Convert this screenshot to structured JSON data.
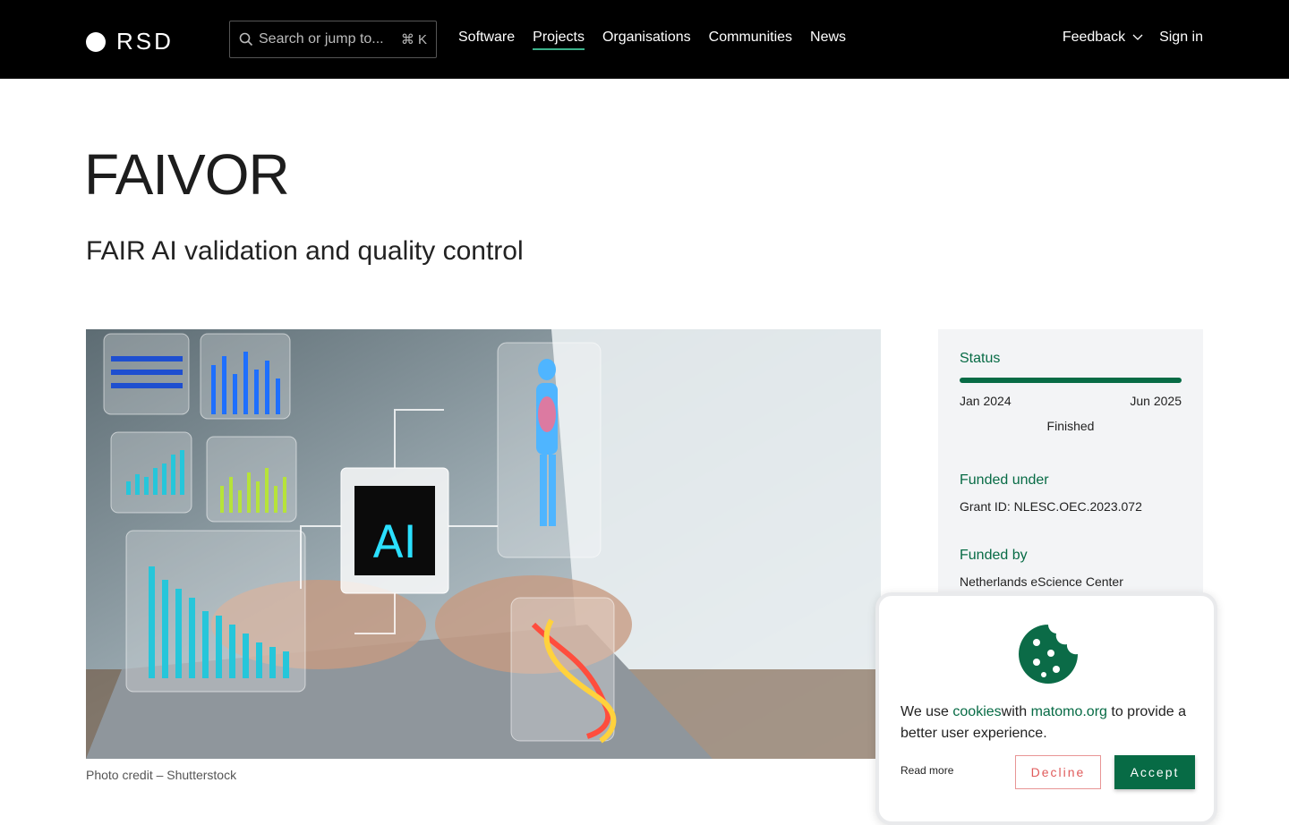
{
  "header": {
    "logo_text": "RSD",
    "search_placeholder": "Search or jump to...",
    "search_shortcut": "⌘ K",
    "nav": [
      {
        "label": "Software",
        "active": false
      },
      {
        "label": "Projects",
        "active": true
      },
      {
        "label": "Organisations",
        "active": false
      },
      {
        "label": "Communities",
        "active": false
      },
      {
        "label": "News",
        "active": false
      }
    ],
    "feedback_label": "Feedback",
    "signin_label": "Sign in"
  },
  "project": {
    "title": "FAIVOR",
    "subtitle": "FAIR AI validation and quality control",
    "image_credit": "Photo credit – Shutterstock",
    "image_icon": "ai-chip-medical-illustration"
  },
  "sidebar": {
    "status_heading": "Status",
    "progress": 1.0,
    "start_date": "Jan 2024",
    "end_date": "Jun 2025",
    "status_text": "Finished",
    "funded_under_heading": "Funded under",
    "grant": "Grant ID: NLESC.OEC.2023.072",
    "funded_by_heading": "Funded by",
    "funder": "Netherlands eScience Center"
  },
  "cookie_banner": {
    "text_before": "We use ",
    "cookies_link": "cookies",
    "text_mid": "with ",
    "matomo_link": "matomo.org",
    "text_after": " to provide a better user experience.",
    "read_more": "Read more",
    "decline_label": "Decline",
    "accept_label": "Accept"
  },
  "colors": {
    "accent": "#076b45",
    "header_bg": "#000000",
    "decline": "#e05b5b"
  }
}
